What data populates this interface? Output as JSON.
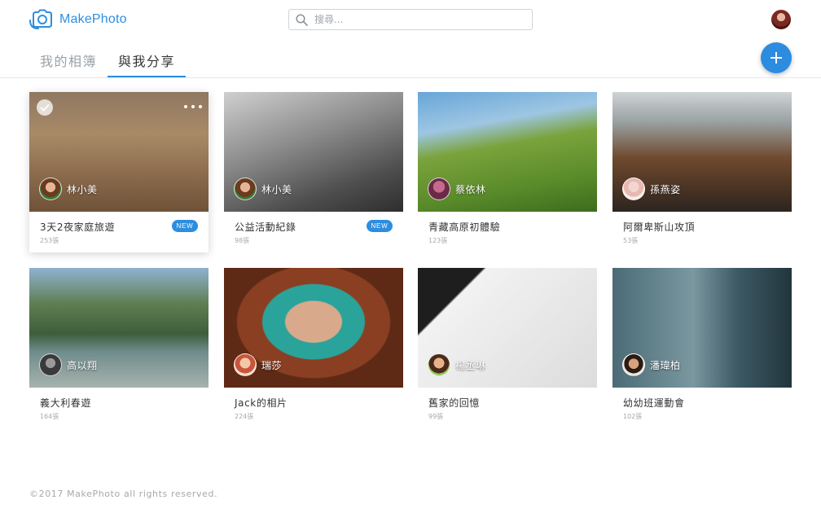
{
  "app": {
    "name": "MakePhoto",
    "brand_color": "#2d8ee0"
  },
  "search": {
    "placeholder": "搜尋..."
  },
  "tabs": [
    {
      "label": "我的相簿",
      "active": false
    },
    {
      "label": "與我分享",
      "active": true
    }
  ],
  "fab": {
    "icon": "plus-icon"
  },
  "albums": [
    {
      "title": "3天2夜家庭旅遊",
      "count": "253張",
      "owner": "林小美",
      "is_new": true,
      "selected": true
    },
    {
      "title": "公益活動紀錄",
      "count": "98張",
      "owner": "林小美",
      "is_new": true
    },
    {
      "title": "青藏高原初體驗",
      "count": "123張",
      "owner": "蔡依林",
      "is_new": false
    },
    {
      "title": "阿爾卑斯山攻頂",
      "count": "53張",
      "owner": "孫燕姿",
      "is_new": false
    },
    {
      "title": "義大利春遊",
      "count": "164張",
      "owner": "高以翔",
      "is_new": false
    },
    {
      "title": "Jack的相片",
      "count": "224張",
      "owner": "瑞莎",
      "is_new": false
    },
    {
      "title": "舊家的回憶",
      "count": "99張",
      "owner": "楊丞琳",
      "is_new": false
    },
    {
      "title": "幼幼班運動會",
      "count": "102張",
      "owner": "潘瑋柏",
      "is_new": false
    }
  ],
  "badge_label": "NEW",
  "footer": {
    "text": "©2017 MakePhoto all rights reserved."
  }
}
